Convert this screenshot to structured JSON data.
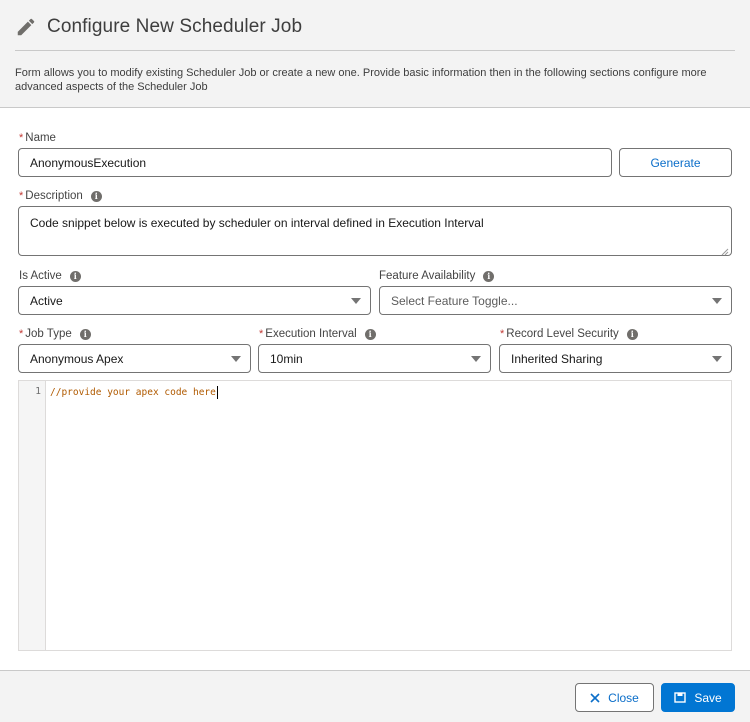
{
  "header": {
    "icon": "pencil-icon",
    "title": "Configure New Scheduler Job",
    "description": "Form allows you to modify existing Scheduler Job or create a new one. Provide basic information then in the following sections configure more advanced aspects of the Scheduler Job"
  },
  "form": {
    "name": {
      "label": "Name",
      "required": true,
      "value": "AnonymousExecution",
      "generate_label": "Generate"
    },
    "description": {
      "label": "Description",
      "required": true,
      "has_info": true,
      "value": "Code snippet below is executed by scheduler on interval defined in Execution Interval"
    },
    "is_active": {
      "label": "Is Active",
      "required": false,
      "has_info": true,
      "value": "Active"
    },
    "feature_availability": {
      "label": "Feature Availability",
      "required": false,
      "has_info": true,
      "placeholder": "Select Feature Toggle..."
    },
    "job_type": {
      "label": "Job Type",
      "required": true,
      "has_info": true,
      "value": "Anonymous Apex"
    },
    "execution_interval": {
      "label": "Execution Interval",
      "required": true,
      "has_info": true,
      "value": "10min"
    },
    "record_level_security": {
      "label": "Record Level Security",
      "required": true,
      "has_info": true,
      "value": "Inherited Sharing"
    },
    "required_marker": "*",
    "info_glyph": "i"
  },
  "editor": {
    "lines": [
      {
        "number": "1",
        "text": "//provide your apex code here"
      }
    ]
  },
  "footer": {
    "close_label": "Close",
    "save_label": "Save"
  },
  "colors": {
    "brand": "#0176d3",
    "link": "#0b6ec9",
    "required": "#c23934",
    "comment": "#b05a00"
  }
}
